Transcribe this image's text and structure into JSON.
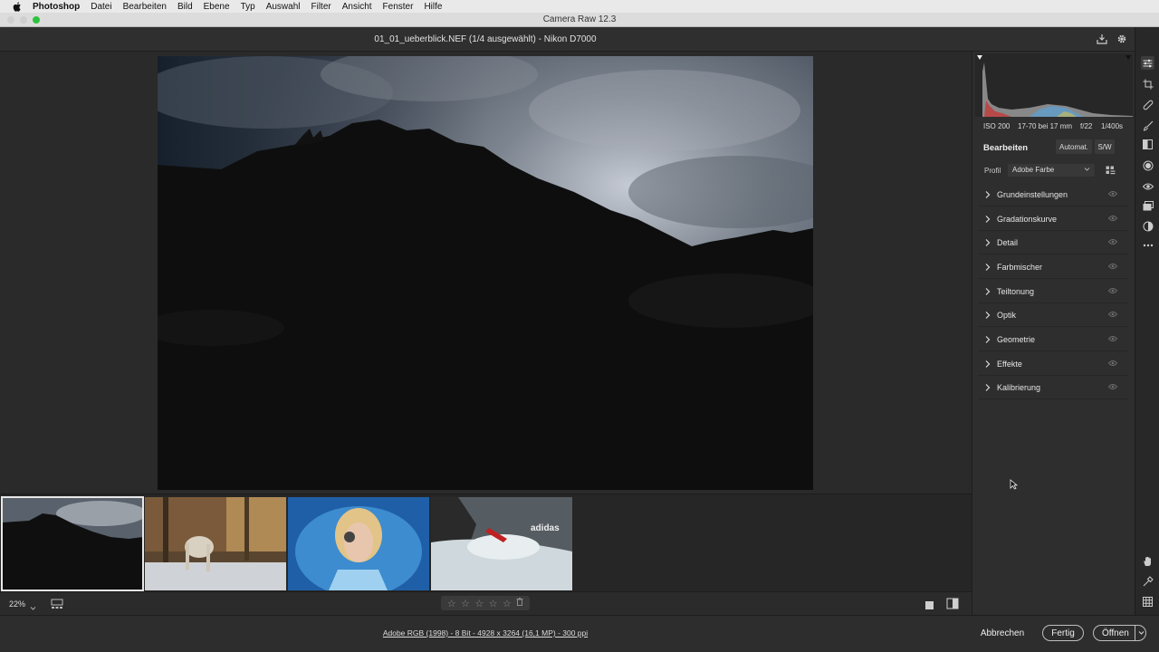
{
  "menubar": {
    "items": [
      "Photoshop",
      "Datei",
      "Bearbeiten",
      "Bild",
      "Ebene",
      "Typ",
      "Auswahl",
      "Filter",
      "Ansicht",
      "Fenster",
      "Hilfe"
    ]
  },
  "window": {
    "title": "Camera Raw 12.3",
    "document_title": "01_01_ueberblick.NEF (1/4 ausgewählt) - Nikon D7000"
  },
  "exif": {
    "iso": "ISO 200",
    "lens": "17-70 bei 17 mm",
    "aperture": "f/22",
    "shutter": "1/400s"
  },
  "edit_panel": {
    "title": "Bearbeiten",
    "auto_label": "Automat.",
    "bw_label": "S/W",
    "profile_label": "Profil",
    "profile_value": "Adobe Farbe",
    "sections": [
      "Grundeinstellungen",
      "Gradationskurve",
      "Detail",
      "Farbmischer",
      "Teiltonung",
      "Optik",
      "Geometrie",
      "Effekte",
      "Kalibrierung"
    ]
  },
  "filmstrip": {
    "selected_index": 0,
    "count": 4
  },
  "bottombar": {
    "zoom": "22%",
    "rating": 0,
    "max_rating": 5
  },
  "footer": {
    "workflow_info": "Adobe RGB (1998) - 8 Bit - 4928 x 3264 (16,1 MP) - 300 ppi",
    "cancel_label": "Abbrechen",
    "done_label": "Fertig",
    "open_label": "Öffnen"
  },
  "colors": {
    "accent_white": "#e8e8e8",
    "panel_bg": "#2e2e2e",
    "canvas_bg": "#2a2a2a"
  }
}
